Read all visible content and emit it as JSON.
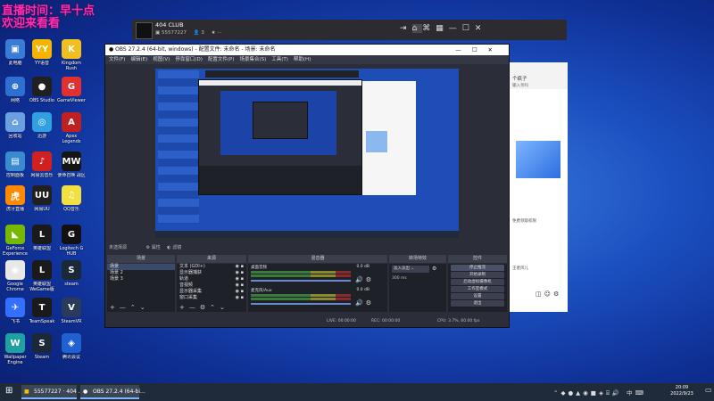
{
  "overlay": {
    "line1": "直播时间：早十点",
    "line2": "欢迎来看看"
  },
  "desktop_icons": [
    {
      "label": "此电脑",
      "color": "#3a7bd5",
      "glyph": "▣"
    },
    {
      "label": "YY语音",
      "color": "#f5b400",
      "glyph": "YY"
    },
    {
      "label": "Kingdom Rush",
      "color": "#f0c020",
      "glyph": "K"
    },
    {
      "label": "网络",
      "color": "#2f6fd0",
      "glyph": "⊕"
    },
    {
      "label": "OBS Studio",
      "color": "#202020",
      "glyph": "●"
    },
    {
      "label": "GameViewer",
      "color": "#e03030",
      "glyph": "G"
    },
    {
      "label": "回收站",
      "color": "#6aa0e0",
      "glyph": "⌂"
    },
    {
      "label": "迅游",
      "color": "#30a0e0",
      "glyph": "◎"
    },
    {
      "label": "Apex Legends",
      "color": "#c02020",
      "glyph": "A"
    },
    {
      "label": "控制面板",
      "color": "#3a8ad0",
      "glyph": "▤"
    },
    {
      "label": "网易云音乐",
      "color": "#d02020",
      "glyph": "♪"
    },
    {
      "label": "使命召唤 战区",
      "color": "#151515",
      "glyph": "MW"
    },
    {
      "label": "虎牙直播",
      "color": "#ff8a00",
      "glyph": "虎"
    },
    {
      "label": "网易UU",
      "color": "#202020",
      "glyph": "UU"
    },
    {
      "label": "QQ音乐",
      "color": "#f0e040",
      "glyph": "♫"
    },
    {
      "label": "GeForce Experience",
      "color": "#76b900",
      "glyph": "◣"
    },
    {
      "label": "英雄联盟",
      "color": "#1a1a1a",
      "glyph": "L"
    },
    {
      "label": "Logitech G HUB",
      "color": "#111111",
      "glyph": "G"
    },
    {
      "label": "Google Chrome",
      "color": "#e8e8e8",
      "glyph": "◉"
    },
    {
      "label": "英雄联盟 WeGame版",
      "color": "#1a1a1a",
      "glyph": "L"
    },
    {
      "label": "steam",
      "color": "#1b2838",
      "glyph": "S"
    },
    {
      "label": "飞书",
      "color": "#3370ff",
      "glyph": "✈"
    },
    {
      "label": "TeamSpeak",
      "color": "#1a1a1a",
      "glyph": "T"
    },
    {
      "label": "SteamVR",
      "color": "#2a3a5a",
      "glyph": "V"
    },
    {
      "label": "Wallpaper Engine",
      "color": "#20a0a0",
      "glyph": "W"
    },
    {
      "label": "Steam",
      "color": "#1b2838",
      "glyph": "S"
    },
    {
      "label": "腾讯会议",
      "color": "#2060d0",
      "glyph": "◈"
    }
  ],
  "club_window": {
    "title": "404 CLUB",
    "room_id": "55577227",
    "viewers": "3"
  },
  "club_side": {
    "line1": "个疯子",
    "line2": "输入亲吗",
    "line3": "免费领取权限",
    "line4": "王者风儿"
  },
  "obs": {
    "title": "OBS 27.2.4 (64-bit, windows) - 配置文件: 未命名 - 场景: 未命名",
    "window_controls": [
      "—",
      "☐",
      "✕"
    ],
    "menu": [
      "文件(F)",
      "编辑(E)",
      "视图(V)",
      "停靠窗口(D)",
      "配置文件(P)",
      "场景集合(S)",
      "工具(T)",
      "帮助(H)"
    ],
    "source_bar": [
      "未选择源",
      "属性",
      "滤镜"
    ],
    "panels": {
      "scenes": "场景",
      "sources": "来源",
      "mixer": "混音器",
      "transitions": "转场特效",
      "controls": "控件"
    },
    "scenes": [
      "场景",
      "场景 2",
      "场景 3"
    ],
    "sources": [
      "文本 (GDI+)",
      "显示器捕获",
      "轨道",
      "音视频",
      "显示器采集",
      "窗口采集"
    ],
    "mixer": [
      {
        "name": "桌面音频",
        "db": "0.0 dB"
      },
      {
        "name": "麦克风/Aux",
        "db": "0.0 dB"
      }
    ],
    "transition": "淡入淡出",
    "duration": "300 ms",
    "controls": [
      "停止推流",
      "开始录制",
      "启动虚拟摄像机",
      "工作室模式",
      "设置",
      "退出"
    ],
    "status": {
      "live": "LIVE: 00:00:00",
      "rec": "REC: 00:00:00",
      "cpu": "CPU: 3.7%, 60.00 fps"
    }
  },
  "taskbar": {
    "apps": [
      "55577227 · 404 ...",
      "OBS 27.2.4 (64-bi..."
    ],
    "time": "20:09",
    "date": "2022/9/23",
    "lang": "中"
  }
}
